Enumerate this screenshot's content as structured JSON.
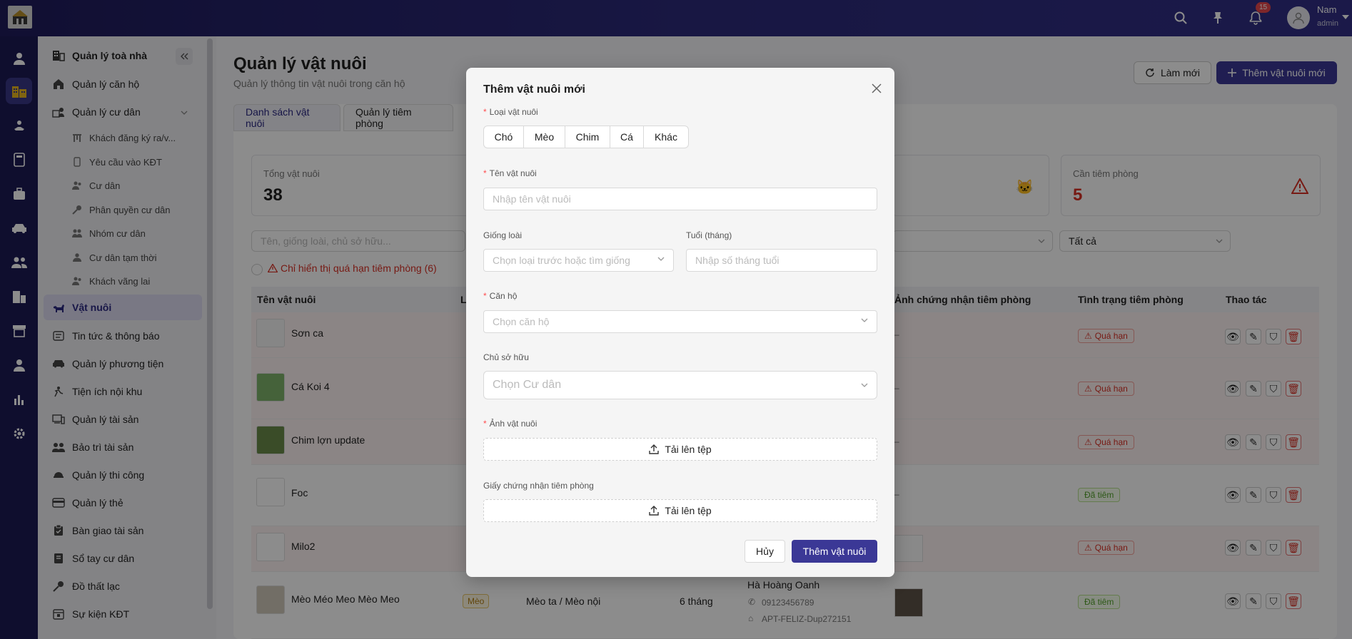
{
  "header": {
    "notification_count": "15",
    "user_name": "Nam",
    "user_role": "admin"
  },
  "sidebar": {
    "items": [
      {
        "label": "Quản lý toà nhà",
        "icon": "building-icon"
      },
      {
        "label": "Quản lý căn hộ",
        "icon": "home-icon"
      },
      {
        "label": "Quản lý cư dân",
        "icon": "residents-icon"
      },
      {
        "label": "Khách đăng ký ra/v...",
        "icon": "gate-icon"
      },
      {
        "label": "Yêu cầu vào KĐT",
        "icon": "phone-icon"
      },
      {
        "label": "Cư dân",
        "icon": "users-icon"
      },
      {
        "label": "Phân quyền cư dân",
        "icon": "key-icon"
      },
      {
        "label": "Nhóm cư dân",
        "icon": "group-icon"
      },
      {
        "label": "Cư dân tạm thời",
        "icon": "user-icon"
      },
      {
        "label": "Khách vãng lai",
        "icon": "visitors-icon"
      },
      {
        "label": "Vật nuôi",
        "icon": "pet-icon"
      },
      {
        "label": "Tin tức & thông báo",
        "icon": "news-icon"
      },
      {
        "label": "Quản lý phương tiện",
        "icon": "car-icon"
      },
      {
        "label": "Tiện ích nội khu",
        "icon": "amenity-icon"
      },
      {
        "label": "Quản lý tài sản",
        "icon": "asset-icon"
      },
      {
        "label": "Bảo trì tài sản",
        "icon": "maintenance-icon"
      },
      {
        "label": "Quản lý thi công",
        "icon": "construction-icon"
      },
      {
        "label": "Quản lý thẻ",
        "icon": "card-icon"
      },
      {
        "label": "Bàn giao tài sản",
        "icon": "handover-icon"
      },
      {
        "label": "Sổ tay cư dân",
        "icon": "handbook-icon"
      },
      {
        "label": "Đồ thất lạc",
        "icon": "lost-icon"
      },
      {
        "label": "Sự kiện KĐT",
        "icon": "event-icon"
      }
    ]
  },
  "page": {
    "title": "Quản lý vật nuôi",
    "subtitle": "Quản lý thông tin vật nuôi trong căn hộ",
    "refresh_label": "Làm mới",
    "add_label": "Thêm vật nuôi mới",
    "tabs": [
      "Danh sách vật nuôi",
      "Quản lý tiêm phòng"
    ],
    "stats": [
      {
        "label": "Tổng vật nuôi",
        "value": "38"
      },
      {
        "label": "Cần tiêm phòng",
        "value": "5"
      }
    ],
    "search_placeholder": "Tên, giống loài, chủ sở hữu...",
    "filter_all": "Tất cả",
    "overdue_filter": "Chỉ hiển thị quá hạn tiêm phòng (6)",
    "columns": [
      "Tên vật nuôi",
      "L",
      "Ảnh chứng nhận tiêm phòng",
      "Tình trạng tiêm phòng",
      "Thao tác"
    ],
    "rows": [
      {
        "name": "Sơn ca",
        "cert": "–",
        "status": "Quá hạn"
      },
      {
        "name": "Cá Koi 4",
        "cert": "–",
        "status": "Quá hạn"
      },
      {
        "name": "Chim lợn update",
        "cert": "–",
        "status": "Quá hạn"
      },
      {
        "name": "Foc",
        "cert": "–",
        "status": "Đã tiêm"
      },
      {
        "name": "Milo2",
        "cert": "",
        "status": "Quá hạn"
      },
      {
        "name": "Mèo Méo Meo Mèo Meo",
        "type": "Mèo",
        "breed": "Mèo ta / Mèo nội",
        "age": "6 tháng",
        "owner": "Hà Hoàng Oanh",
        "phone": "09123456789",
        "apartment": "APT-FELIZ-Dup272151",
        "status": "Đã tiêm"
      }
    ]
  },
  "modal": {
    "title": "Thêm vật nuôi mới",
    "pet_type_label": "Loại vật nuôi",
    "pet_types": [
      "Chó",
      "Mèo",
      "Chim",
      "Cá",
      "Khác"
    ],
    "name_label": "Tên vật nuôi",
    "name_placeholder": "Nhập tên vật nuôi",
    "breed_label": "Giống loài",
    "breed_placeholder": "Chọn loại trước hoặc tìm giống",
    "age_label": "Tuổi (tháng)",
    "age_placeholder": "Nhập số tháng tuổi",
    "apartment_label": "Căn hộ",
    "apartment_placeholder": "Chọn căn hộ",
    "owner_label": "Chủ sở hữu",
    "owner_placeholder": "Chọn Cư dân",
    "photo_label": "Ảnh vật nuôi",
    "upload_label": "Tải lên tệp",
    "vaccine_label": "Giấy chứng nhận tiêm phòng",
    "cancel_label": "Hủy",
    "submit_label": "Thêm vật nuôi"
  }
}
